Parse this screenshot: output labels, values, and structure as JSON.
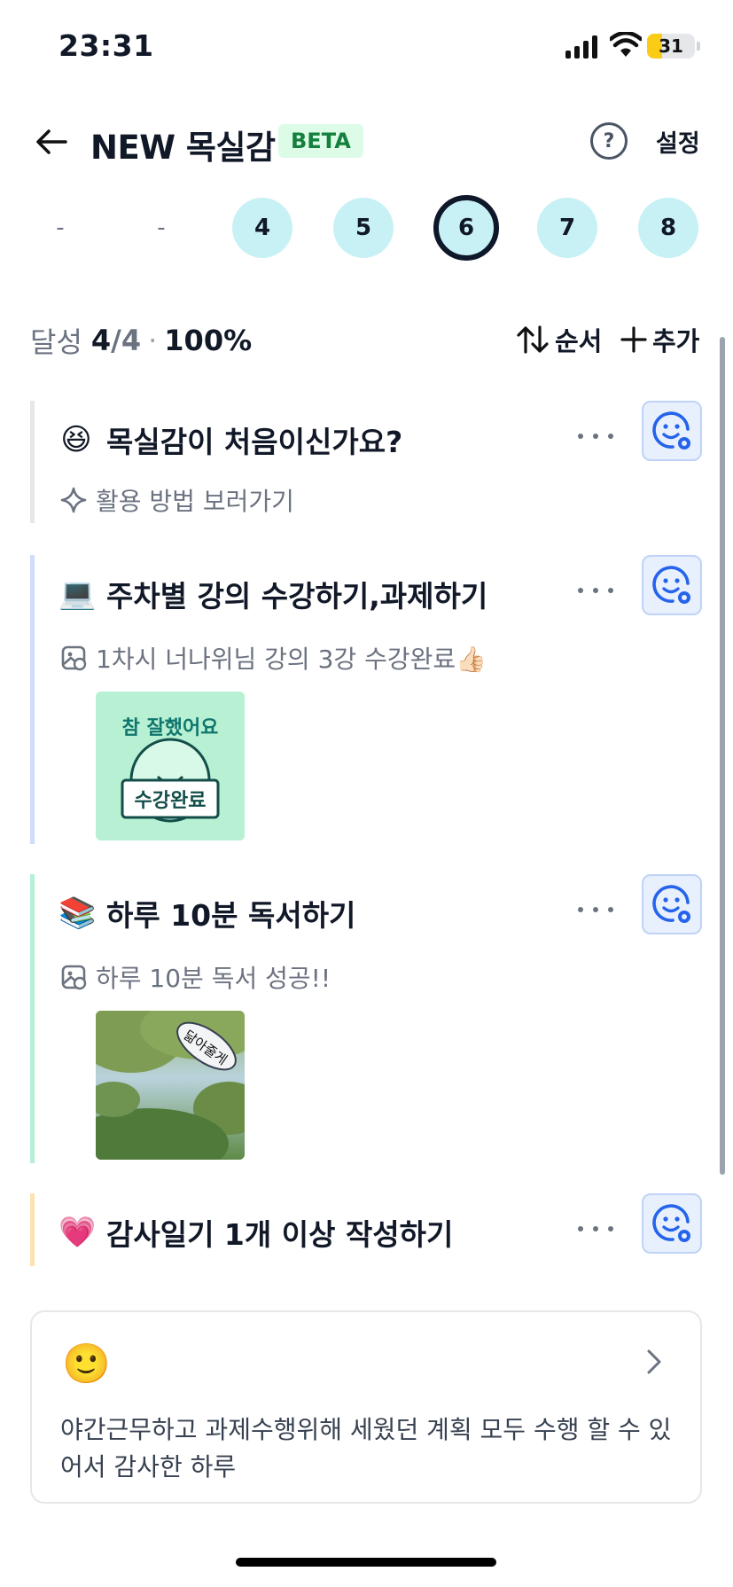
{
  "status_bar": {
    "time": "23:31",
    "battery": "31",
    "battery_level": 0.31
  },
  "header": {
    "title": "NEW 목실감",
    "badge": "BETA",
    "help_icon_label": "?",
    "settings_label": "설정"
  },
  "week": {
    "days": [
      "-",
      "-",
      "4",
      "5",
      "6",
      "7",
      "8"
    ],
    "selected": "6"
  },
  "summary": {
    "label": "달성",
    "done": "4",
    "total": "/4",
    "separator": "·",
    "percent": "100%"
  },
  "actions": {
    "order_label": "순서",
    "add_label": "추가"
  },
  "tasks": [
    {
      "emoji": "😆",
      "title": "목실감이 처음이신가요?",
      "note": "활용 방법 보러가기",
      "bar_color": "#e5e7eb",
      "has_photo": false
    },
    {
      "emoji": "💻",
      "title": "주차별 강의 수강하기,과제하기",
      "note": "1차시 너나위님 강의 3강 수강완료👍🏻",
      "bar_color": "#cfdcfb",
      "has_photo": true,
      "photo_text_top": "참 잘했어요",
      "photo_text_board": "수강완료"
    },
    {
      "emoji": "📚",
      "title": "하루 10분 독서하기",
      "note": "하루 10분 독서 성공!!",
      "bar_color": "#b5f0d6",
      "has_photo": true,
      "photo_bubble": "닮아줄게"
    },
    {
      "emoji": "💗",
      "title": "감사일기 1개 이상 작성하기",
      "note": "",
      "bar_color": "#fde2b0",
      "has_photo": false
    }
  ],
  "gratitude": {
    "emoji": "🙂",
    "text": "야간근무하고 과제수행위해 세웠던 계획 모두 수행 할 수 있어서 감사한 하루"
  }
}
